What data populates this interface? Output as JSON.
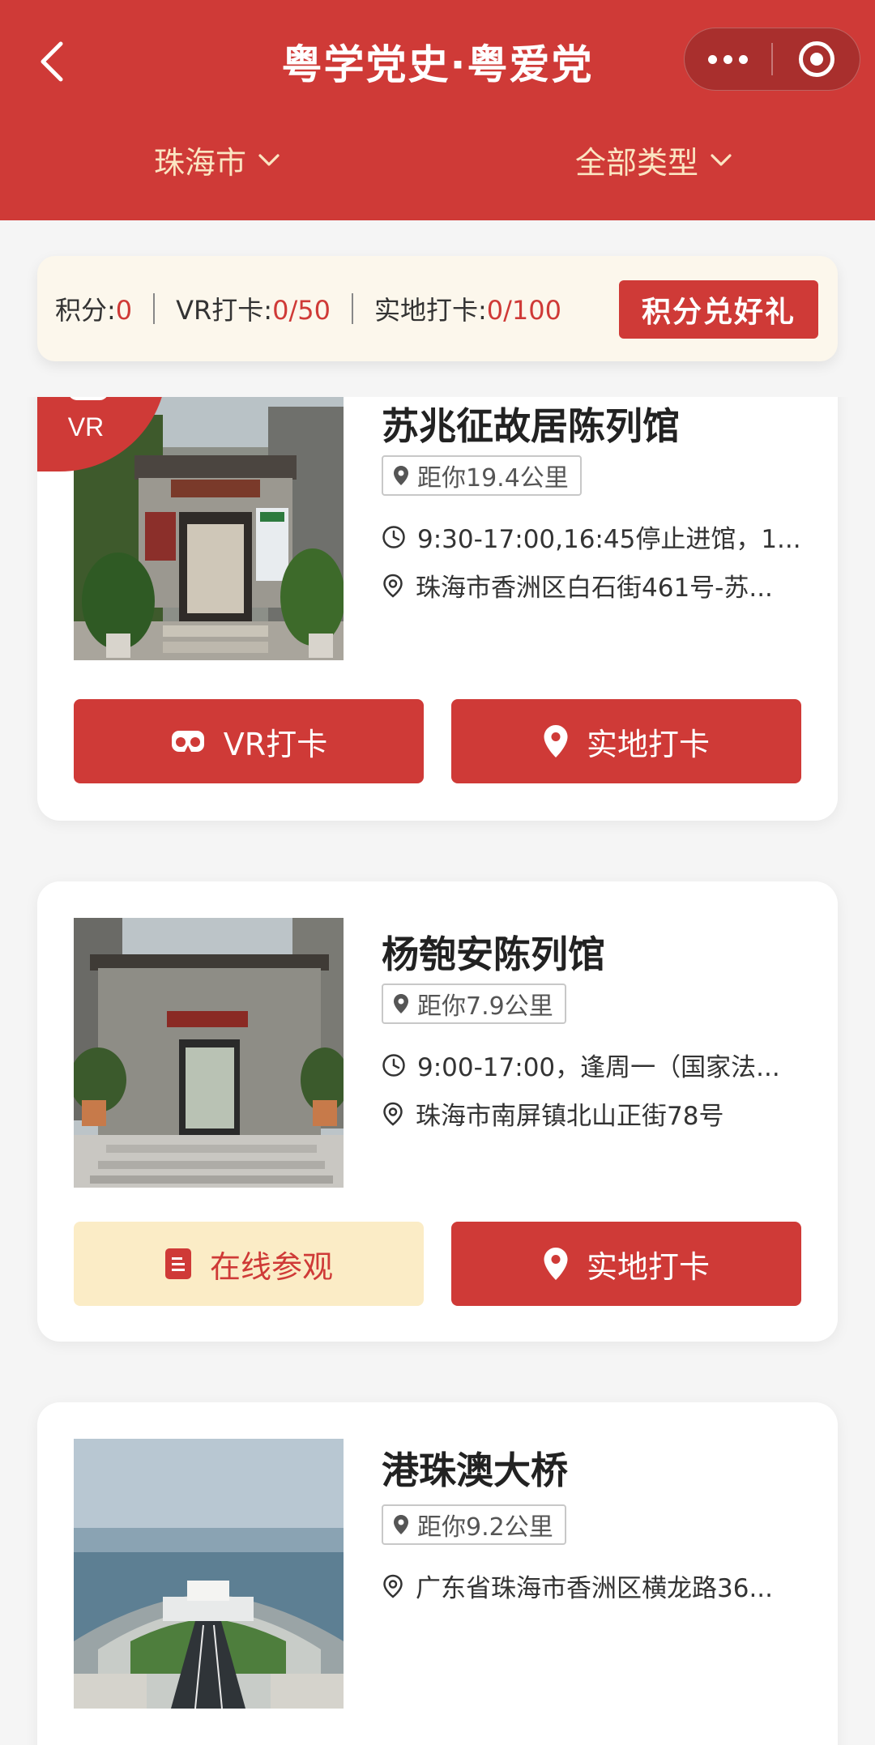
{
  "header": {
    "title": "粤学党史·粤爱党",
    "filter_city": "珠海市",
    "filter_type": "全部类型",
    "bg_color": "#cf3a37"
  },
  "stats": {
    "points_label": "积分:",
    "points_value": "0",
    "vr_label": "VR打卡:",
    "vr_value": "0/50",
    "onsite_label": "实地打卡:",
    "onsite_value": "0/100",
    "redeem_label": "积分兑好礼"
  },
  "cards": [
    {
      "badge": "VR",
      "title": "苏兆征故居陈列馆",
      "distance": "距你19.4公里",
      "hours": "9:30-17:00,16:45停止进馆，1...",
      "address": "珠海市香洲区白石街461号-苏...",
      "btn_left": "VR打卡",
      "btn_right": "实地打卡"
    },
    {
      "title": "杨匏安陈列馆",
      "distance": "距你7.9公里",
      "hours": "9:00-17:00，逢周一（国家法...",
      "address": "珠海市南屏镇北山正街78号",
      "btn_left": "在线参观",
      "btn_right": "实地打卡"
    },
    {
      "title": "港珠澳大桥",
      "distance": "距你9.2公里",
      "address": "广东省珠海市香洲区横龙路36..."
    }
  ],
  "icons": {
    "back": "chevron-left-icon",
    "more": "more-dots-icon",
    "close": "target-icon",
    "location": "location-pin-icon",
    "clock": "clock-icon",
    "vr": "vr-glasses-icon",
    "document": "document-icon"
  }
}
